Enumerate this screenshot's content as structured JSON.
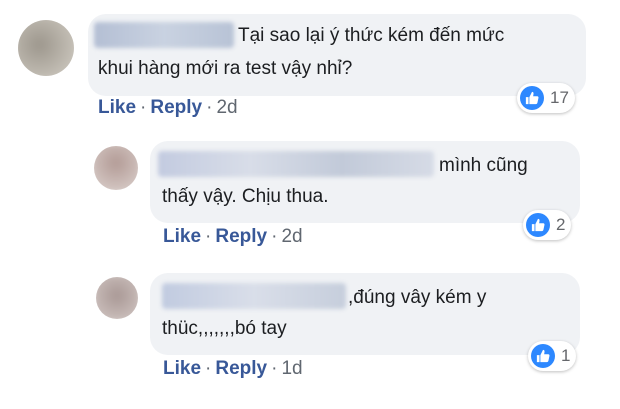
{
  "comments": [
    {
      "text": "Tại sao lại ý thức kém đến mức khui hàng mới ra test vậy nhỉ?",
      "line1": "Tại sao lại ý thức kém đến mức",
      "line2": "khui hàng mới ra test vậy nhỉ?",
      "like_label": "Like",
      "reply_label": "Reply",
      "time": "2d",
      "reaction_icon": "thumbs-up-icon",
      "reaction_count": "17"
    },
    {
      "text": "mình cũng thấy vậy. Chịu thua.",
      "line1": "mình cũng",
      "line2": "thấy vậy. Chịu thua.",
      "like_label": "Like",
      "reply_label": "Reply",
      "time": "2d",
      "reaction_icon": "thumbs-up-icon",
      "reaction_count": "2"
    },
    {
      "text": ",đúng vây kém y thüc,,,,,,,bó tay",
      "line1": ",đúng vây kém y",
      "line2": "thüc,,,,,,,bó tay",
      "like_label": "Like",
      "reply_label": "Reply",
      "time": "1d",
      "reaction_icon": "thumbs-up-icon",
      "reaction_count": "1"
    }
  ],
  "separator": "·",
  "colors": {
    "bubble": "#f0f2f5",
    "link": "#385898",
    "meta": "#606770",
    "like_badge": "#2d88ff"
  }
}
